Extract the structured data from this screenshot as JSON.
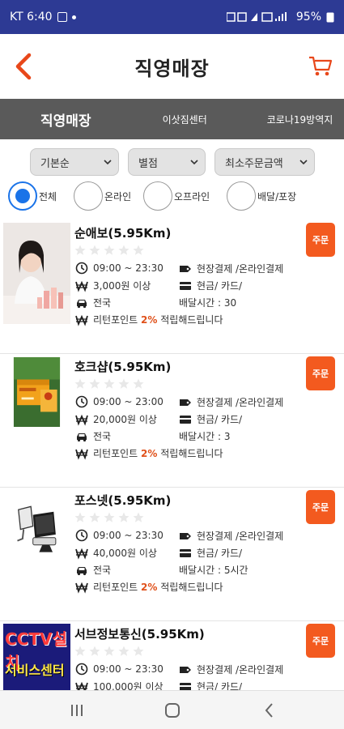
{
  "status": {
    "carrier_time": "KT 6:40",
    "battery": "95%"
  },
  "header": {
    "title": "직영매장"
  },
  "tabs": [
    "직영매장",
    "이삿짐센터",
    "코로나19방역지"
  ],
  "filters": [
    "기본순",
    "별점",
    "최소주문금액"
  ],
  "radios": [
    "전체",
    "온라인",
    "오프라인",
    "배달/포장"
  ],
  "order_label": "주문",
  "accent": "#f35a1f",
  "stores": [
    {
      "name": "순애보(5.95Km)",
      "hours": "09:00 ~ 23:30",
      "pay": "현장결제 /온라인결제",
      "min": "3,000원 이상",
      "method": "현금/ 카드/",
      "area": "전국",
      "delivery": "배달시간 : 30",
      "point_pre": "리턴포인트",
      "point_pct": "2%",
      "point_post": "적립해드립니다",
      "thumb": "woman-cosmetics-icon"
    },
    {
      "name": "호크샵(5.95Km)",
      "hours": "09:00 ~ 23:00",
      "pay": "현장결제 /온라인결제",
      "min": "20,000원 이상",
      "method": "현금/ 카드/",
      "area": "전국",
      "delivery": "배달시간 : 3",
      "point_pre": "리턴포인트",
      "point_pct": "2%",
      "point_post": "적립해드립니다",
      "thumb": "gift-box-icon"
    },
    {
      "name": "포스넷(5.95Km)",
      "hours": "09:00 ~ 23:30",
      "pay": "현장결제 /온라인결제",
      "min": "40,000원 이상",
      "method": "현금/ 카드/",
      "area": "전국",
      "delivery": "배달시간 : 5시간",
      "point_pre": "리턴포인트",
      "point_pct": "2%",
      "point_post": "적립해드립니다",
      "thumb": "pos-terminal-icon"
    },
    {
      "name": "서브정보통신(5.95Km)",
      "hours": "09:00 ~ 23:30",
      "pay": "현장결제 /온라인결제",
      "min": "100,000원 이상",
      "method": "현금/ 카드/",
      "area": "",
      "delivery": "",
      "point_pre": "",
      "point_pct": "",
      "point_post": "",
      "thumb": "cctv-banner-icon",
      "banner_line1": "CCTV설치",
      "banner_line2": "서비스센터"
    }
  ]
}
